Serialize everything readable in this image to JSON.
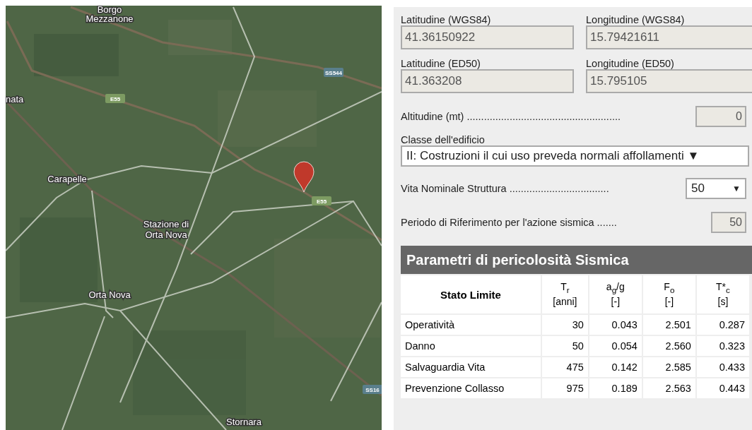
{
  "map": {
    "places": [
      "Borgo",
      "Mezzanone",
      "nata",
      "Carapelle",
      "Stazione di",
      "Orta Nova",
      "Orta Nova",
      "Stornara"
    ],
    "shields": [
      "SS544",
      "E55",
      "E55",
      "SS16"
    ]
  },
  "coordinates": [
    {
      "label": "Latitudine (WGS84)",
      "value": "41.36150922"
    },
    {
      "label": "Longitudine (WGS84)",
      "value": "15.79421611"
    },
    {
      "label": "Latitudine (ED50)",
      "value": "41.363208"
    },
    {
      "label": "Longitudine (ED50)",
      "value": "15.795105"
    }
  ],
  "altitude": {
    "label": "Altitudine (mt) ......................................................",
    "value": "0"
  },
  "building_class": {
    "label": "Classe dell'edificio",
    "value": "II: Costruzioni il cui uso preveda normali affollamenti",
    "arrow": "▼"
  },
  "nominal_life": {
    "label": "Vita Nominale Struttura ...................................",
    "value": "50",
    "arrow": "▼"
  },
  "reference_period": {
    "label": "Periodo di Riferimento per l'azione sismica .......",
    "value": "50"
  },
  "table": {
    "title": "Parametri di pericolosità Sismica",
    "columns": [
      {
        "name": "Stato Limite"
      },
      {
        "name": "T$_{r}$",
        "unit": "[anni]"
      },
      {
        "name": "a$_{g}$/g",
        "unit": "[-]"
      },
      {
        "name": "F$_{o}$",
        "unit": "[-]"
      },
      {
        "name": "T*$_{c}$",
        "unit": "[s]"
      }
    ],
    "rows": [
      [
        "Operatività",
        "30",
        "0.043",
        "2.501",
        "0.287"
      ],
      [
        "Danno",
        "50",
        "0.054",
        "2.560",
        "0.323"
      ],
      [
        "Salvaguardia Vita",
        "475",
        "0.142",
        "2.585",
        "0.433"
      ],
      [
        "Prevenzione Collasso",
        "975",
        "0.189",
        "2.563",
        "0.443"
      ]
    ]
  }
}
